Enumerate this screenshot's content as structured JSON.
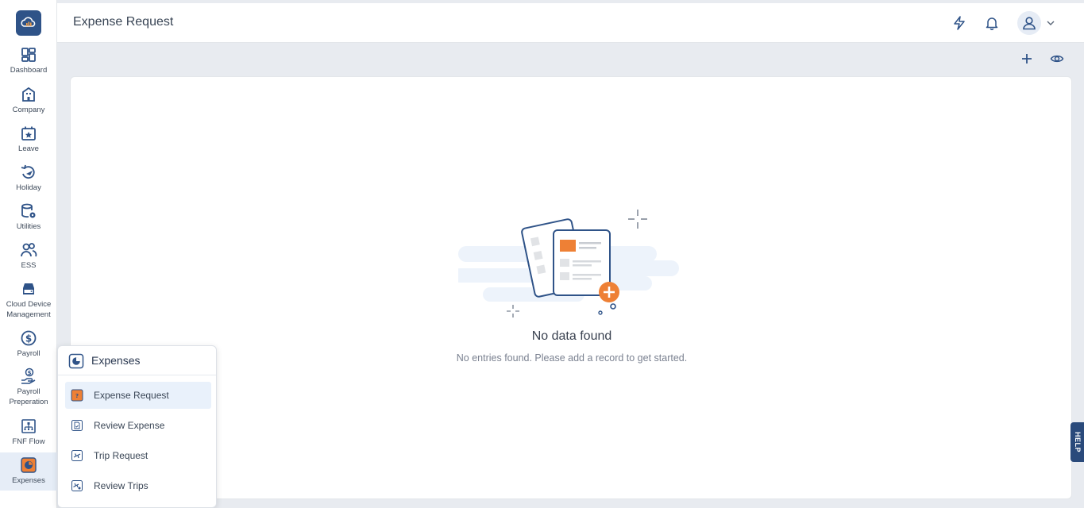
{
  "header": {
    "title": "Expense Request"
  },
  "sidebar": {
    "items": [
      {
        "label": "Dashboard"
      },
      {
        "label": "Company"
      },
      {
        "label": "Leave"
      },
      {
        "label": "Holiday"
      },
      {
        "label": "Utilities"
      },
      {
        "label": "ESS"
      },
      {
        "label": "Cloud Device Management"
      },
      {
        "label": "Payroll"
      },
      {
        "label": "Payroll Preperation"
      },
      {
        "label": "FNF Flow"
      },
      {
        "label": "Expenses"
      }
    ]
  },
  "flyout": {
    "title": "Expenses",
    "items": [
      {
        "label": "Expense Request"
      },
      {
        "label": "Review Expense"
      },
      {
        "label": "Trip Request"
      },
      {
        "label": "Review Trips"
      }
    ]
  },
  "empty_state": {
    "title": "No data found",
    "subtitle": "No entries found. Please add a record to get started."
  },
  "help": {
    "label": "HELP"
  },
  "colors": {
    "brand": "#2f5388",
    "accent": "#ee8035",
    "selected_bg": "#e9f1fb"
  },
  "icons": [
    "logo-cloud-icon",
    "dashboard-icon",
    "company-icon",
    "leave-icon",
    "holiday-icon",
    "utilities-icon",
    "ess-icon",
    "cloud-device-icon",
    "payroll-icon",
    "payroll-preperation-icon",
    "fnf-flow-icon",
    "expenses-icon",
    "lightning-icon",
    "bell-icon",
    "user-icon",
    "chevron-down-icon",
    "plus-icon",
    "eye-icon"
  ]
}
